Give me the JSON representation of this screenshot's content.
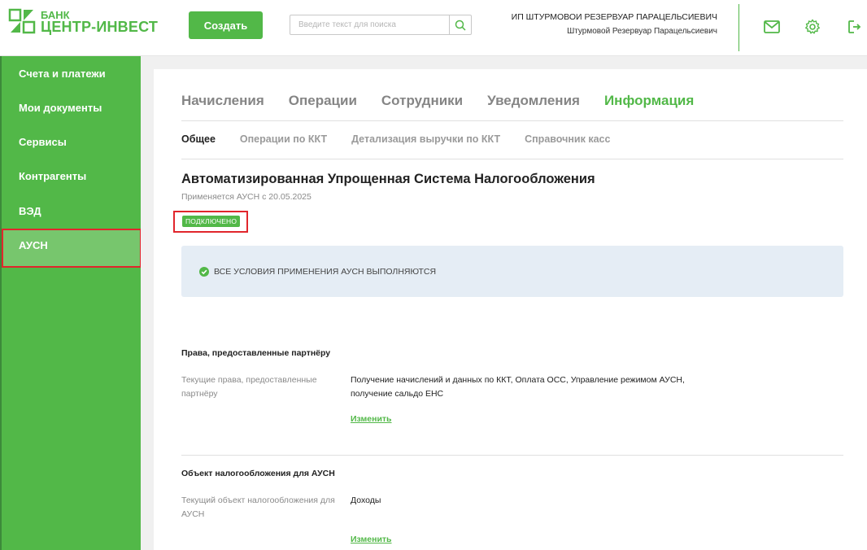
{
  "brand": {
    "line1": "БАНК",
    "line2": "ЦЕНТР-ИНВЕСТ",
    "color": "#52b848"
  },
  "header": {
    "create_label": "Создать",
    "search_placeholder": "Введите текст для поиска",
    "user_company": "ИП ШТУРМОВОИ РЕЗЕРВУАР ПАРАЦЕЛЬСИЕВИЧ",
    "user_name": "Штурмовой Резервуар Парацельсиевич",
    "icons": [
      "mail-icon",
      "gear-icon",
      "logout-icon"
    ]
  },
  "sidebar": {
    "items": [
      {
        "label": "Счета и платежи"
      },
      {
        "label": "Мои документы"
      },
      {
        "label": "Сервисы"
      },
      {
        "label": "Контрагенты"
      },
      {
        "label": "ВЭД"
      },
      {
        "label": "АУСН",
        "active": true
      }
    ]
  },
  "main": {
    "tabs": [
      {
        "label": "Начисления"
      },
      {
        "label": "Операции"
      },
      {
        "label": "Сотрудники"
      },
      {
        "label": "Уведомления"
      },
      {
        "label": "Информация",
        "active": true
      }
    ],
    "subtabs": [
      {
        "label": "Общее",
        "active": true
      },
      {
        "label": "Операции по ККТ"
      },
      {
        "label": "Детализация выручки по ККТ"
      },
      {
        "label": "Справочник касс"
      }
    ],
    "title": "Автоматизированная Упрощенная Система Налогообложения",
    "applies_since": "Применяется АУСН с 20.05.2025",
    "status_badge": "ПОДКЛЮЧЕНО",
    "notice": "ВСЕ УСЛОВИЯ ПРИМЕНЕНИЯ АУСН ВЫПОЛНЯЮТСЯ",
    "sections": [
      {
        "title": "Права, предоставленные партнёру",
        "label": "Текущие права, предоставленные партнёру",
        "value": "Получение начислений и данных по ККТ, Оплата ОСС, Управление режимом АУСН, получение сальдо ЕНС",
        "link": "Изменить"
      },
      {
        "title": "Объект налогообложения для АУСН",
        "label": "Текущий объект налогообложения для АУСН",
        "value": "Доходы",
        "link": "Изменить"
      }
    ]
  }
}
